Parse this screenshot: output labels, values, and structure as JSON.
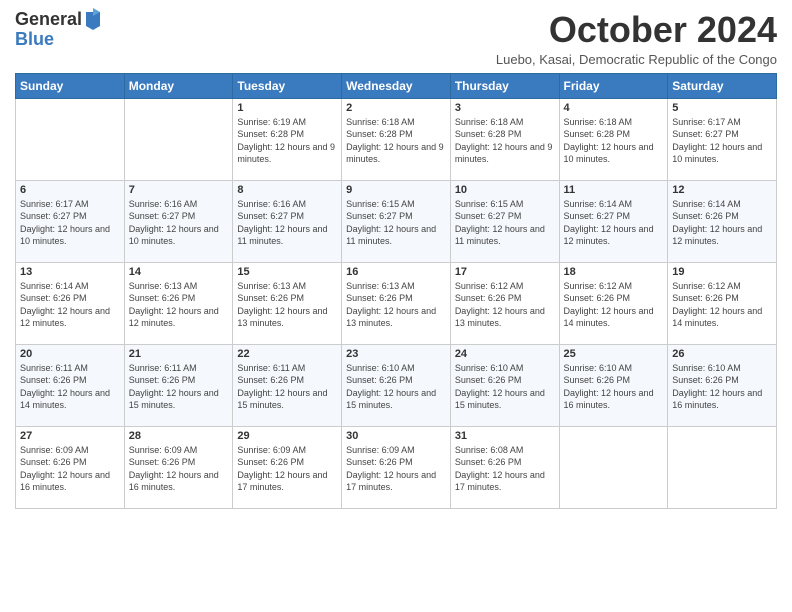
{
  "logo": {
    "general": "General",
    "blue": "Blue"
  },
  "header": {
    "title": "October 2024",
    "subtitle": "Luebo, Kasai, Democratic Republic of the Congo"
  },
  "weekdays": [
    "Sunday",
    "Monday",
    "Tuesday",
    "Wednesday",
    "Thursday",
    "Friday",
    "Saturday"
  ],
  "weeks": [
    [
      {
        "day": "",
        "info": ""
      },
      {
        "day": "",
        "info": ""
      },
      {
        "day": "1",
        "info": "Sunrise: 6:19 AM\nSunset: 6:28 PM\nDaylight: 12 hours and 9 minutes."
      },
      {
        "day": "2",
        "info": "Sunrise: 6:18 AM\nSunset: 6:28 PM\nDaylight: 12 hours and 9 minutes."
      },
      {
        "day": "3",
        "info": "Sunrise: 6:18 AM\nSunset: 6:28 PM\nDaylight: 12 hours and 9 minutes."
      },
      {
        "day": "4",
        "info": "Sunrise: 6:18 AM\nSunset: 6:28 PM\nDaylight: 12 hours and 10 minutes."
      },
      {
        "day": "5",
        "info": "Sunrise: 6:17 AM\nSunset: 6:27 PM\nDaylight: 12 hours and 10 minutes."
      }
    ],
    [
      {
        "day": "6",
        "info": "Sunrise: 6:17 AM\nSunset: 6:27 PM\nDaylight: 12 hours and 10 minutes."
      },
      {
        "day": "7",
        "info": "Sunrise: 6:16 AM\nSunset: 6:27 PM\nDaylight: 12 hours and 10 minutes."
      },
      {
        "day": "8",
        "info": "Sunrise: 6:16 AM\nSunset: 6:27 PM\nDaylight: 12 hours and 11 minutes."
      },
      {
        "day": "9",
        "info": "Sunrise: 6:15 AM\nSunset: 6:27 PM\nDaylight: 12 hours and 11 minutes."
      },
      {
        "day": "10",
        "info": "Sunrise: 6:15 AM\nSunset: 6:27 PM\nDaylight: 12 hours and 11 minutes."
      },
      {
        "day": "11",
        "info": "Sunrise: 6:14 AM\nSunset: 6:27 PM\nDaylight: 12 hours and 12 minutes."
      },
      {
        "day": "12",
        "info": "Sunrise: 6:14 AM\nSunset: 6:26 PM\nDaylight: 12 hours and 12 minutes."
      }
    ],
    [
      {
        "day": "13",
        "info": "Sunrise: 6:14 AM\nSunset: 6:26 PM\nDaylight: 12 hours and 12 minutes."
      },
      {
        "day": "14",
        "info": "Sunrise: 6:13 AM\nSunset: 6:26 PM\nDaylight: 12 hours and 12 minutes."
      },
      {
        "day": "15",
        "info": "Sunrise: 6:13 AM\nSunset: 6:26 PM\nDaylight: 12 hours and 13 minutes."
      },
      {
        "day": "16",
        "info": "Sunrise: 6:13 AM\nSunset: 6:26 PM\nDaylight: 12 hours and 13 minutes."
      },
      {
        "day": "17",
        "info": "Sunrise: 6:12 AM\nSunset: 6:26 PM\nDaylight: 12 hours and 13 minutes."
      },
      {
        "day": "18",
        "info": "Sunrise: 6:12 AM\nSunset: 6:26 PM\nDaylight: 12 hours and 14 minutes."
      },
      {
        "day": "19",
        "info": "Sunrise: 6:12 AM\nSunset: 6:26 PM\nDaylight: 12 hours and 14 minutes."
      }
    ],
    [
      {
        "day": "20",
        "info": "Sunrise: 6:11 AM\nSunset: 6:26 PM\nDaylight: 12 hours and 14 minutes."
      },
      {
        "day": "21",
        "info": "Sunrise: 6:11 AM\nSunset: 6:26 PM\nDaylight: 12 hours and 15 minutes."
      },
      {
        "day": "22",
        "info": "Sunrise: 6:11 AM\nSunset: 6:26 PM\nDaylight: 12 hours and 15 minutes."
      },
      {
        "day": "23",
        "info": "Sunrise: 6:10 AM\nSunset: 6:26 PM\nDaylight: 12 hours and 15 minutes."
      },
      {
        "day": "24",
        "info": "Sunrise: 6:10 AM\nSunset: 6:26 PM\nDaylight: 12 hours and 15 minutes."
      },
      {
        "day": "25",
        "info": "Sunrise: 6:10 AM\nSunset: 6:26 PM\nDaylight: 12 hours and 16 minutes."
      },
      {
        "day": "26",
        "info": "Sunrise: 6:10 AM\nSunset: 6:26 PM\nDaylight: 12 hours and 16 minutes."
      }
    ],
    [
      {
        "day": "27",
        "info": "Sunrise: 6:09 AM\nSunset: 6:26 PM\nDaylight: 12 hours and 16 minutes."
      },
      {
        "day": "28",
        "info": "Sunrise: 6:09 AM\nSunset: 6:26 PM\nDaylight: 12 hours and 16 minutes."
      },
      {
        "day": "29",
        "info": "Sunrise: 6:09 AM\nSunset: 6:26 PM\nDaylight: 12 hours and 17 minutes."
      },
      {
        "day": "30",
        "info": "Sunrise: 6:09 AM\nSunset: 6:26 PM\nDaylight: 12 hours and 17 minutes."
      },
      {
        "day": "31",
        "info": "Sunrise: 6:08 AM\nSunset: 6:26 PM\nDaylight: 12 hours and 17 minutes."
      },
      {
        "day": "",
        "info": ""
      },
      {
        "day": "",
        "info": ""
      }
    ]
  ]
}
